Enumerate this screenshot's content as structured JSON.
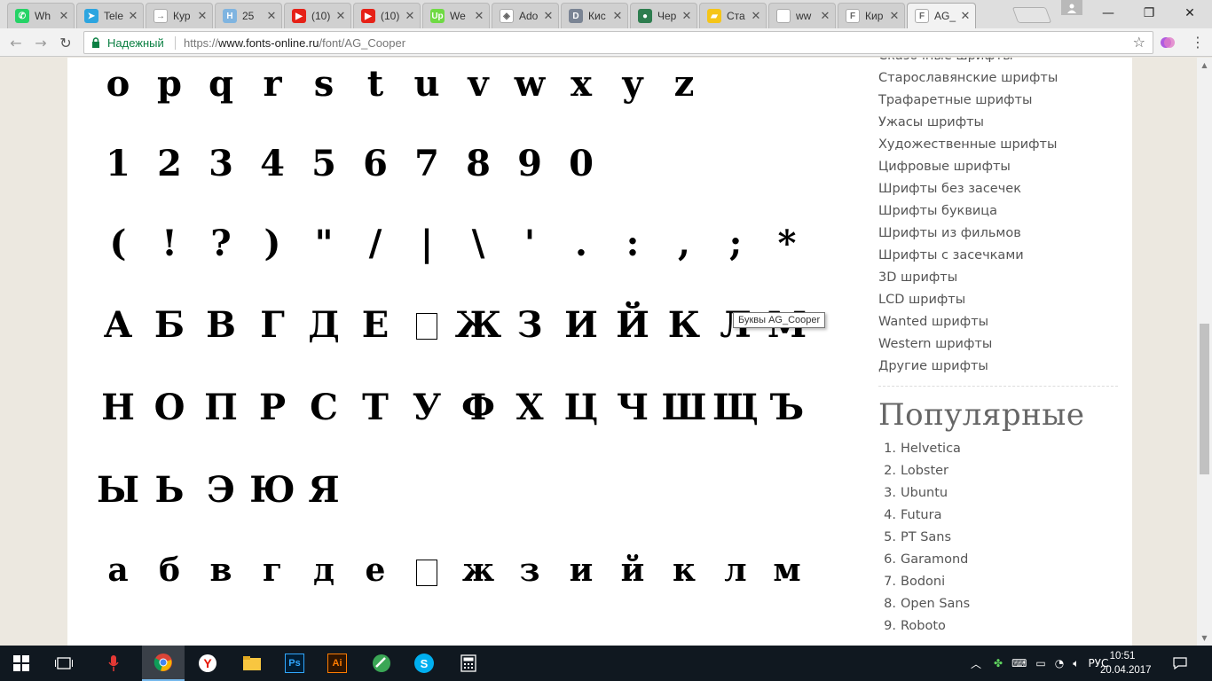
{
  "browser": {
    "tabs": [
      {
        "title": "Wh",
        "favicon": "whatsapp-icon",
        "color": "#25d366",
        "glyph": "✆"
      },
      {
        "title": "Tele",
        "favicon": "telegram-icon",
        "color": "#2ca5e0",
        "glyph": "➤"
      },
      {
        "title": "Кур",
        "favicon": "arrow-icon",
        "color": "#ffffff",
        "glyph": "→"
      },
      {
        "title": "25",
        "favicon": "hh-icon",
        "color": "#7fb4e0",
        "glyph": "H"
      },
      {
        "title": "(10)",
        "favicon": "youtube-icon",
        "color": "#e62117",
        "glyph": "▶"
      },
      {
        "title": "(10)",
        "favicon": "youtube-icon",
        "color": "#e62117",
        "glyph": "▶"
      },
      {
        "title": "We",
        "favicon": "upwork-icon",
        "color": "#6fda44",
        "glyph": "Up"
      },
      {
        "title": "Ado",
        "favicon": "adobe-stock-icon",
        "color": "#ffffff",
        "glyph": "◈"
      },
      {
        "title": "Кис",
        "favicon": "d-icon",
        "color": "#7a8494",
        "glyph": "D"
      },
      {
        "title": "Чер",
        "favicon": "circle-icon",
        "color": "#2e7d4f",
        "glyph": "●"
      },
      {
        "title": "Ста",
        "favicon": "stock-icon",
        "color": "#f5c518",
        "glyph": "▰"
      },
      {
        "title": "ww",
        "favicon": "page-icon",
        "color": "#ffffff",
        "glyph": ""
      },
      {
        "title": "Кир",
        "favicon": "fonts-online-icon",
        "color": "#ffffff",
        "glyph": "F"
      },
      {
        "title": "AG_",
        "favicon": "fonts-online-icon",
        "color": "#ffffff",
        "glyph": "F"
      }
    ],
    "window_controls": {
      "minimize": "—",
      "maximize": "❐",
      "close": "✕"
    },
    "address": {
      "secure_label": "Надежный",
      "url_scheme": "https://",
      "url_host": "www.fonts-online.ru",
      "url_path": "/font/AG_Cooper"
    }
  },
  "glyph_rows": [
    {
      "glyphs": [
        "o",
        "p",
        "q",
        "r",
        "s",
        "t",
        "u",
        "v",
        "w",
        "x",
        "y",
        "z"
      ]
    },
    {
      "glyphs": [
        "1",
        "2",
        "3",
        "4",
        "5",
        "6",
        "7",
        "8",
        "9",
        "0"
      ]
    },
    {
      "glyphs": [
        "(",
        "!",
        "?",
        ")",
        "\"",
        "/",
        "|",
        "\\",
        "'",
        ".",
        ":",
        ",",
        ";",
        "*"
      ]
    },
    {
      "glyphs": [
        "А",
        "Б",
        "В",
        "Г",
        "Д",
        "Е",
        "□",
        "Ж",
        "З",
        "И",
        "Й",
        "К",
        "Л",
        "М"
      ]
    },
    {
      "glyphs": [
        "Н",
        "О",
        "П",
        "Р",
        "С",
        "Т",
        "У",
        "Ф",
        "Х",
        "Ц",
        "Ч",
        "Ш",
        "Щ",
        "Ъ"
      ]
    },
    {
      "glyphs": [
        "Ы",
        "Ь",
        "Э",
        "Ю",
        "Я"
      ]
    },
    {
      "glyphs": [
        "а",
        "б",
        "в",
        "г",
        "д",
        "е",
        "□",
        "ж",
        "з",
        "и",
        "й",
        "к",
        "л",
        "м"
      ]
    }
  ],
  "tooltip": "Буквы AG_Cooper",
  "sidebar": {
    "categories": [
      "Сказочные шрифты",
      "Старославянские шрифты",
      "Трафаретные шрифты",
      "Ужасы шрифты",
      "Художественные шрифты",
      "Цифровые шрифты",
      "Шрифты без засечек",
      "Шрифты буквица",
      "Шрифты из фильмов",
      "Шрифты с засечками",
      "3D шрифты",
      "LCD шрифты",
      "Wanted шрифты",
      "Western шрифты",
      "Другие шрифты"
    ],
    "popular_heading": "Популярные",
    "popular": [
      {
        "num": "1.",
        "name": "Helvetica"
      },
      {
        "num": "2.",
        "name": "Lobster"
      },
      {
        "num": "3.",
        "name": "Ubuntu"
      },
      {
        "num": "4.",
        "name": "Futura"
      },
      {
        "num": "5.",
        "name": "PT Sans"
      },
      {
        "num": "6.",
        "name": "Garamond"
      },
      {
        "num": "7.",
        "name": "Bodoni"
      },
      {
        "num": "8.",
        "name": "Open Sans"
      },
      {
        "num": "9.",
        "name": "Roboto"
      }
    ]
  },
  "taskbar": {
    "apps": [
      {
        "name": "start-icon"
      },
      {
        "name": "task-view-icon"
      },
      {
        "name": "microphone-icon"
      },
      {
        "name": "chrome-icon"
      },
      {
        "name": "yandex-icon"
      },
      {
        "name": "file-explorer-icon"
      },
      {
        "name": "photoshop-icon",
        "label": "Ps"
      },
      {
        "name": "illustrator-icon",
        "label": "Ai"
      },
      {
        "name": "green-app-icon"
      },
      {
        "name": "skype-icon",
        "label": "S"
      },
      {
        "name": "calculator-icon"
      }
    ],
    "language": "РУС",
    "time": "10:51",
    "date": "20.04.2017"
  }
}
